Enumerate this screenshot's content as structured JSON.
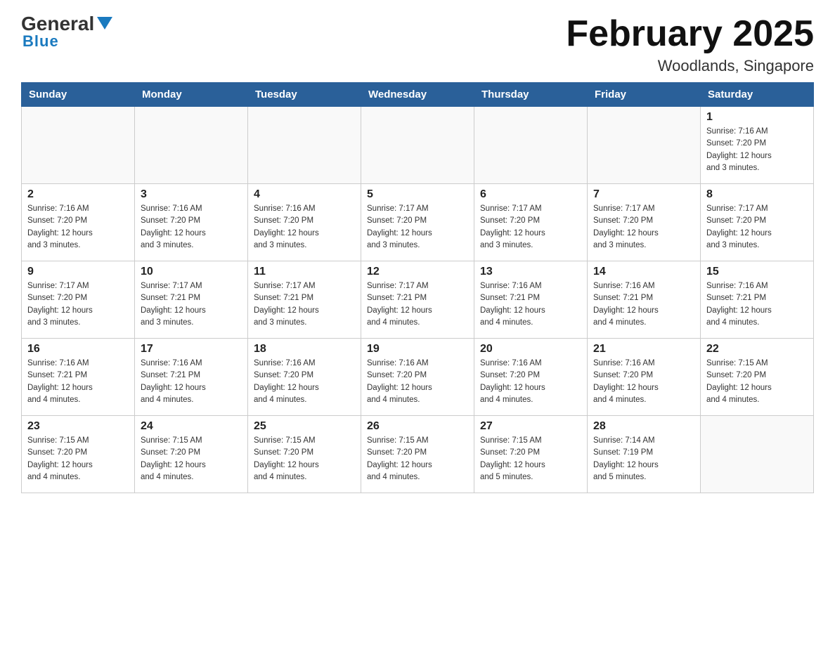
{
  "header": {
    "logo_general": "General",
    "logo_blue": "Blue",
    "title": "February 2025",
    "subtitle": "Woodlands, Singapore"
  },
  "days_of_week": [
    "Sunday",
    "Monday",
    "Tuesday",
    "Wednesday",
    "Thursday",
    "Friday",
    "Saturday"
  ],
  "weeks": [
    [
      {
        "day": "",
        "info": ""
      },
      {
        "day": "",
        "info": ""
      },
      {
        "day": "",
        "info": ""
      },
      {
        "day": "",
        "info": ""
      },
      {
        "day": "",
        "info": ""
      },
      {
        "day": "",
        "info": ""
      },
      {
        "day": "1",
        "info": "Sunrise: 7:16 AM\nSunset: 7:20 PM\nDaylight: 12 hours\nand 3 minutes."
      }
    ],
    [
      {
        "day": "2",
        "info": "Sunrise: 7:16 AM\nSunset: 7:20 PM\nDaylight: 12 hours\nand 3 minutes."
      },
      {
        "day": "3",
        "info": "Sunrise: 7:16 AM\nSunset: 7:20 PM\nDaylight: 12 hours\nand 3 minutes."
      },
      {
        "day": "4",
        "info": "Sunrise: 7:16 AM\nSunset: 7:20 PM\nDaylight: 12 hours\nand 3 minutes."
      },
      {
        "day": "5",
        "info": "Sunrise: 7:17 AM\nSunset: 7:20 PM\nDaylight: 12 hours\nand 3 minutes."
      },
      {
        "day": "6",
        "info": "Sunrise: 7:17 AM\nSunset: 7:20 PM\nDaylight: 12 hours\nand 3 minutes."
      },
      {
        "day": "7",
        "info": "Sunrise: 7:17 AM\nSunset: 7:20 PM\nDaylight: 12 hours\nand 3 minutes."
      },
      {
        "day": "8",
        "info": "Sunrise: 7:17 AM\nSunset: 7:20 PM\nDaylight: 12 hours\nand 3 minutes."
      }
    ],
    [
      {
        "day": "9",
        "info": "Sunrise: 7:17 AM\nSunset: 7:20 PM\nDaylight: 12 hours\nand 3 minutes."
      },
      {
        "day": "10",
        "info": "Sunrise: 7:17 AM\nSunset: 7:21 PM\nDaylight: 12 hours\nand 3 minutes."
      },
      {
        "day": "11",
        "info": "Sunrise: 7:17 AM\nSunset: 7:21 PM\nDaylight: 12 hours\nand 3 minutes."
      },
      {
        "day": "12",
        "info": "Sunrise: 7:17 AM\nSunset: 7:21 PM\nDaylight: 12 hours\nand 4 minutes."
      },
      {
        "day": "13",
        "info": "Sunrise: 7:16 AM\nSunset: 7:21 PM\nDaylight: 12 hours\nand 4 minutes."
      },
      {
        "day": "14",
        "info": "Sunrise: 7:16 AM\nSunset: 7:21 PM\nDaylight: 12 hours\nand 4 minutes."
      },
      {
        "day": "15",
        "info": "Sunrise: 7:16 AM\nSunset: 7:21 PM\nDaylight: 12 hours\nand 4 minutes."
      }
    ],
    [
      {
        "day": "16",
        "info": "Sunrise: 7:16 AM\nSunset: 7:21 PM\nDaylight: 12 hours\nand 4 minutes."
      },
      {
        "day": "17",
        "info": "Sunrise: 7:16 AM\nSunset: 7:21 PM\nDaylight: 12 hours\nand 4 minutes."
      },
      {
        "day": "18",
        "info": "Sunrise: 7:16 AM\nSunset: 7:20 PM\nDaylight: 12 hours\nand 4 minutes."
      },
      {
        "day": "19",
        "info": "Sunrise: 7:16 AM\nSunset: 7:20 PM\nDaylight: 12 hours\nand 4 minutes."
      },
      {
        "day": "20",
        "info": "Sunrise: 7:16 AM\nSunset: 7:20 PM\nDaylight: 12 hours\nand 4 minutes."
      },
      {
        "day": "21",
        "info": "Sunrise: 7:16 AM\nSunset: 7:20 PM\nDaylight: 12 hours\nand 4 minutes."
      },
      {
        "day": "22",
        "info": "Sunrise: 7:15 AM\nSunset: 7:20 PM\nDaylight: 12 hours\nand 4 minutes."
      }
    ],
    [
      {
        "day": "23",
        "info": "Sunrise: 7:15 AM\nSunset: 7:20 PM\nDaylight: 12 hours\nand 4 minutes."
      },
      {
        "day": "24",
        "info": "Sunrise: 7:15 AM\nSunset: 7:20 PM\nDaylight: 12 hours\nand 4 minutes."
      },
      {
        "day": "25",
        "info": "Sunrise: 7:15 AM\nSunset: 7:20 PM\nDaylight: 12 hours\nand 4 minutes."
      },
      {
        "day": "26",
        "info": "Sunrise: 7:15 AM\nSunset: 7:20 PM\nDaylight: 12 hours\nand 4 minutes."
      },
      {
        "day": "27",
        "info": "Sunrise: 7:15 AM\nSunset: 7:20 PM\nDaylight: 12 hours\nand 5 minutes."
      },
      {
        "day": "28",
        "info": "Sunrise: 7:14 AM\nSunset: 7:19 PM\nDaylight: 12 hours\nand 5 minutes."
      },
      {
        "day": "",
        "info": ""
      }
    ]
  ]
}
